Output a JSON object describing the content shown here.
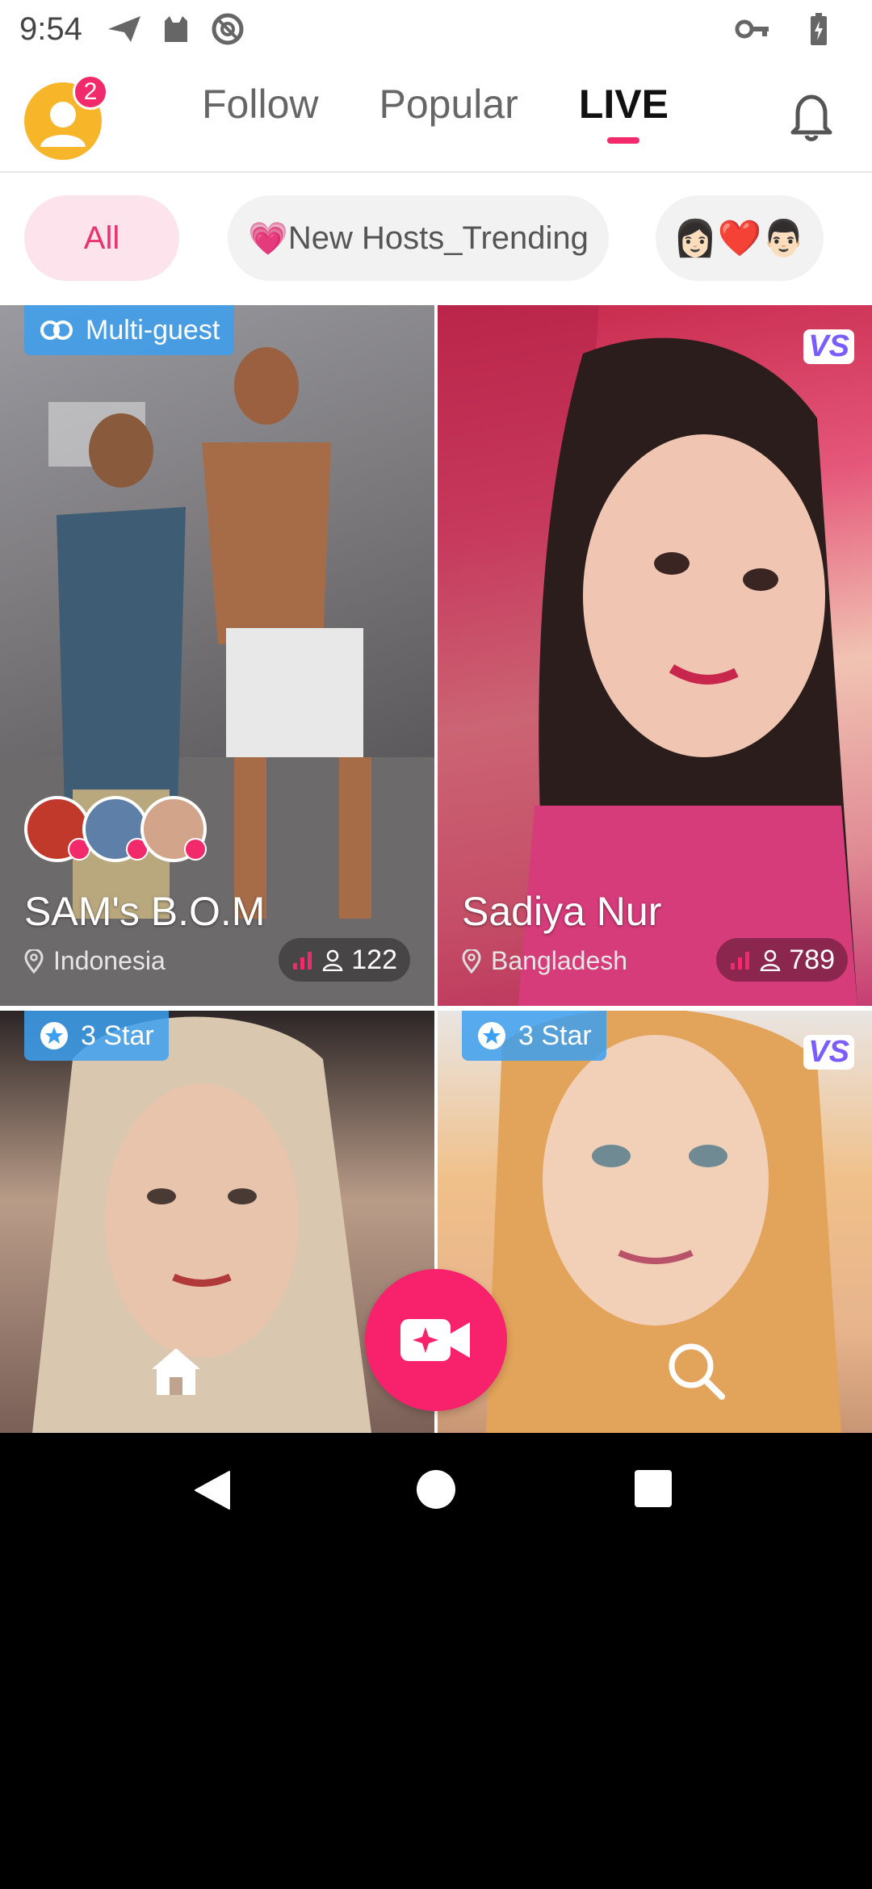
{
  "status_bar": {
    "time": "9:54",
    "icons": [
      "send-icon",
      "cat-icon",
      "no-disturb-icon",
      "key-icon",
      "battery-icon"
    ]
  },
  "header": {
    "notification_badge": "2",
    "tabs": [
      {
        "label": "Follow",
        "active": false
      },
      {
        "label": "Popular",
        "active": false
      },
      {
        "label": "LIVE",
        "active": true
      }
    ]
  },
  "filters": {
    "all": "All",
    "trending": "New Hosts_Trending",
    "trending_emoji": "💗",
    "couples_emoji": "👩🏻❤️👨🏻"
  },
  "cards": [
    {
      "tag": "Multi-guest",
      "name": "SAM's B.O.M",
      "location": "Indonesia",
      "viewers": "122",
      "vs": false
    },
    {
      "tag": "",
      "name": "Sadiya Nur",
      "location": "Bangladesh",
      "viewers": "789",
      "vs": true,
      "vs_label": "VS"
    },
    {
      "tag": "3 Star",
      "name": "",
      "location": "",
      "viewers": "",
      "vs": false
    },
    {
      "tag": "3 Star",
      "name": "",
      "location": "",
      "viewers": "",
      "vs": true,
      "vs_label": "VS"
    }
  ],
  "colors": {
    "accent": "#f2296b",
    "tag_blue": "#3ca0f0",
    "chip_active_bg": "#fde3ec"
  }
}
